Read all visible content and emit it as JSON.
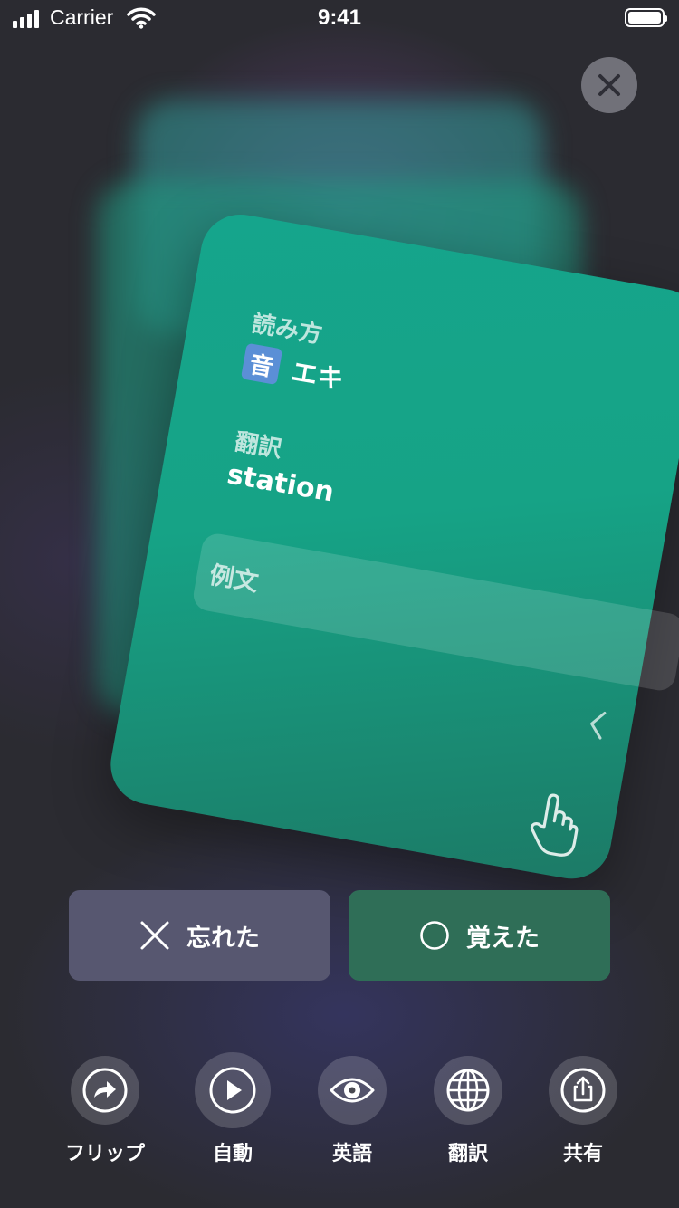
{
  "status_bar": {
    "carrier": "Carrier",
    "time": "9:41"
  },
  "card": {
    "reading_label": "読み方",
    "audio_badge": "音",
    "reading_value": "エキ",
    "translation_label": "翻訳",
    "translation_value": "station",
    "example_label": "例文"
  },
  "actions": {
    "forgot_label": "忘れた",
    "learned_label": "覚えた"
  },
  "toolbar": {
    "flip_label": "フリップ",
    "auto_label": "自動",
    "english_label": "英語",
    "translation_label": "翻訳",
    "share_label": "共有"
  },
  "colors": {
    "card": "#16a386",
    "forgot_button": "#575770",
    "learned_button": "#2f6e57",
    "audio_badge": "#5b8fd6"
  }
}
